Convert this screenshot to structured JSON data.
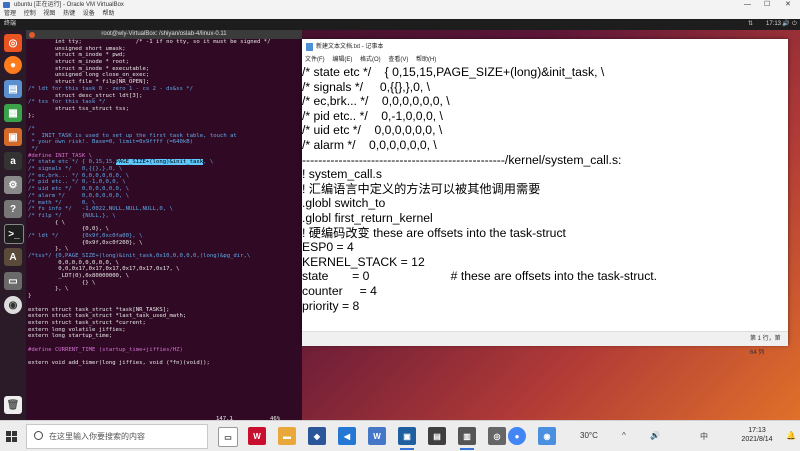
{
  "vbox": {
    "title": "ubuntu [正在运行] - Oracle VM VirtualBox",
    "menu": [
      "管理",
      "控制",
      "视图",
      "热键",
      "设备",
      "帮助"
    ],
    "controls": [
      "—",
      "☐",
      "✕"
    ]
  },
  "ubuntu": {
    "activities": "终端",
    "clock": "17:13",
    "tray": [
      "⇅",
      "🔊",
      "⏻"
    ]
  },
  "terminal": {
    "title": "root@wly-VirtualBox: /shiyan/oslab-4/linux-0.11",
    "lines": [
      "        int tty;                /* -1 if no tty, so it must be signed */",
      "        unsigned short umask;",
      "        struct m_inode * pwd;",
      "        struct m_inode * root;",
      "        struct m_inode * executable;",
      "        unsigned long close_on_exec;",
      "        struct file * filp[NR_OPEN];",
      "/* ldt for this task 0 - zero 1 - cs 2 - ds&ss */",
      "        struct desc_struct ldt[3];",
      "/* tss for this task */",
      "        struct tss_struct tss;",
      "};",
      "",
      "/*",
      " *  INIT_TASK is used to set up the first task table, touch at",
      " * your own risk!. Base=0, limit=0x9ffff (=640kB)",
      " */",
      "#define INIT_TASK \\",
      "/* state etc */ { 0,15,15,PAGE_SIZE+(long)&init_task, \\",
      "/* signals */   0,{{},},0, \\",
      "/* ec,brk... */ 0,0,0,0,0,0, \\",
      "/* pid etc.. */ 0,-1,0,0,0, \\",
      "/* uid etc */   0,0,0,0,0,0, \\",
      "/* alarm */     0,0,0,0,0,0, \\",
      "/* math */      0, \\",
      "/* fs info */   -1,0022,NULL,NULL,NULL,0, \\",
      "/* filp */      {NULL,}, \\",
      "        { \\",
      "                {0,0}, \\",
      "/* ldt */       {0x9f,0xc0fa00}, \\",
      "                {0x9f,0xc0f200}, \\",
      "        }, \\",
      "/*tss*/ {0,PAGE_SIZE+(long)&init_task,0x10,0,0,0,0,(long)&pg_dir,\\",
      "         0,0,0,0,0,0,0,0, \\",
      "         0,0,0x17,0x17,0x17,0x17,0x17,0x17, \\",
      "         _LDT(0),0x80000000, \\",
      "                {} \\",
      "        }, \\",
      "}",
      "",
      "extern struct task_struct *task[NR_TASKS];",
      "extern struct task_struct *last_task_used_math;",
      "extern struct task_struct *current;",
      "extern long volatile jiffies;",
      "extern long startup_time;",
      "",
      "#define CURRENT_TIME (startup_time+jiffies/HZ)",
      "",
      "extern void add_timer(long jiffies, void (*fn)(void));"
    ],
    "status_pos": "147,1",
    "status_pct": "46%"
  },
  "notepad": {
    "title": "新建文本文档.txt - 记事本",
    "menu": [
      "文件(F)",
      "编辑(E)",
      "格式(O)",
      "查看(V)",
      "帮助(H)"
    ],
    "lines": [
      "/* state etc */    { 0,15,15,PAGE_SIZE+(long)&init_task, \\",
      "/* signals */     0,{{},},0, \\",
      "/* ec,brk... */    0,0,0,0,0,0, \\",
      "/* pid etc.. */    0,-1,0,0,0, \\",
      "/* uid etc */    0,0,0,0,0,0, \\",
      "/* alarm */    0,0,0,0,0,0, \\",
      "--------------------------------------------------/kernel/system_call.s:",
      "! system_call.s",
      "! 汇编语言中定义的方法可以被其他调用需要",
      ".globl switch_to",
      ".globl first_return_kernel",
      "! 硬编码改变 these are offsets into the task-struct",
      "ESP0 = 4",
      "KERNEL_STACK = 12",
      "",
      "state       = 0                        # these are offsets into the task-struct.",
      "counter     = 4",
      "priority = 8"
    ],
    "status": "第 1 行，第 64 列"
  },
  "taskbar": {
    "search_placeholder": "在这里输入你要搜索的内容",
    "temperature": "30°C",
    "time": "17:13",
    "date": "2021/8/14",
    "tray_icons": [
      "^",
      "🔊",
      "中",
      "🔔"
    ]
  },
  "colors": {
    "terminal_bg": "#300a24",
    "comment": "#5fa8e8",
    "highlight": "#5ec8ff"
  }
}
